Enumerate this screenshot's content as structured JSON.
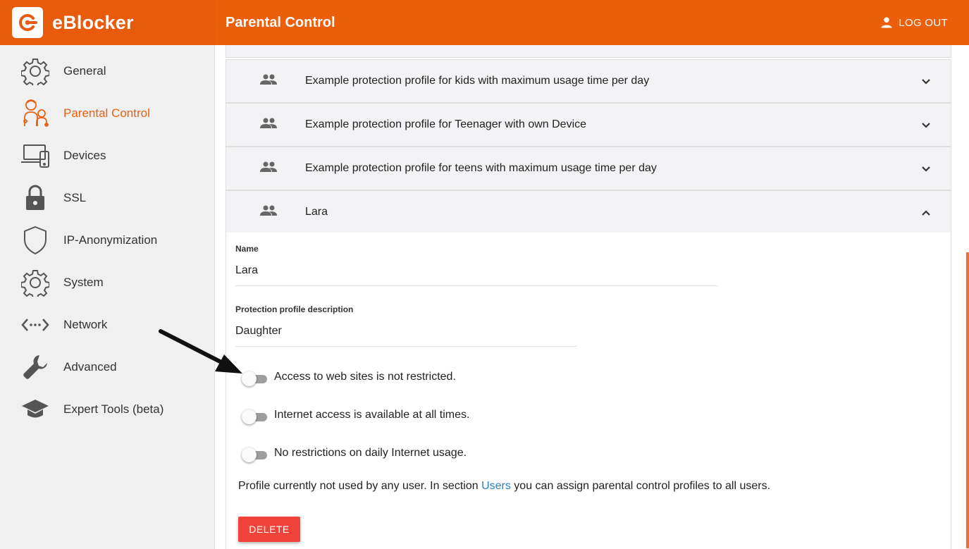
{
  "app": {
    "name": "eBlocker"
  },
  "header": {
    "title": "Parental Control",
    "logout_label": "LOG OUT"
  },
  "sidebar": {
    "items": [
      {
        "label": "General",
        "icon": "gear-icon",
        "active": false
      },
      {
        "label": "Parental Control",
        "icon": "family-icon",
        "active": true
      },
      {
        "label": "Devices",
        "icon": "devices-icon",
        "active": false
      },
      {
        "label": "SSL",
        "icon": "lock-icon",
        "active": false
      },
      {
        "label": "IP-Anonymization",
        "icon": "shield-icon",
        "active": false
      },
      {
        "label": "System",
        "icon": "gear-icon",
        "active": false
      },
      {
        "label": "Network",
        "icon": "network-icon",
        "active": false
      },
      {
        "label": "Advanced",
        "icon": "wrench-icon",
        "active": false
      },
      {
        "label": "Expert Tools (beta)",
        "icon": "graduation-cap-icon",
        "active": false
      }
    ]
  },
  "profiles": [
    {
      "label": "Example protection profile for kids with maximum usage time per day",
      "expanded": false
    },
    {
      "label": "Example protection profile for Teenager with own Device",
      "expanded": false
    },
    {
      "label": "Example protection profile for teens with maximum usage time per day",
      "expanded": false
    },
    {
      "label": "Lara",
      "expanded": true
    }
  ],
  "profile_detail": {
    "name_label": "Name",
    "name_value": "Lara",
    "description_label": "Protection profile description",
    "description_value": "Daughter",
    "toggles": [
      {
        "label": "Access to web sites is not restricted.",
        "on": false
      },
      {
        "label": "Internet access is available at all times.",
        "on": false
      },
      {
        "label": "No restrictions on daily Internet usage.",
        "on": false
      }
    ],
    "info_prefix": "Profile currently not used by any user. In section ",
    "info_link": "Users",
    "info_suffix": " you can assign parental control profiles to all users.",
    "delete_label": "DELETE"
  },
  "colors": {
    "brand": "#ec5f0a",
    "active_nav": "#e8600f",
    "delete": "#f0433a",
    "link": "#2a7fbf"
  }
}
